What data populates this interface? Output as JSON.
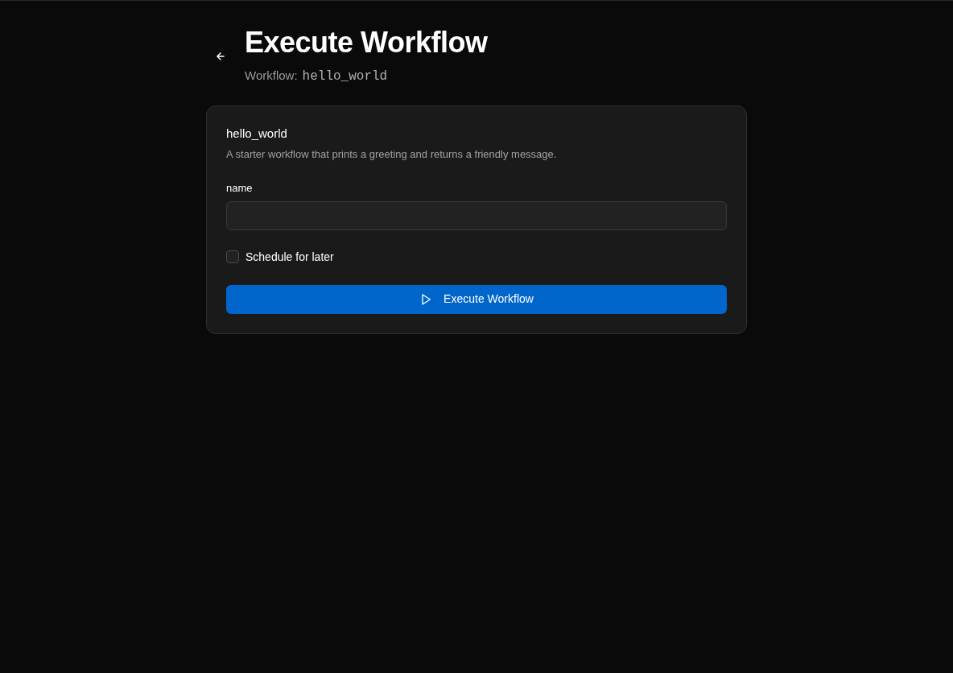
{
  "header": {
    "title": "Execute Workflow",
    "subtitle_label": "Workflow:",
    "workflow_name": "hello_world"
  },
  "card": {
    "title": "hello_world",
    "description": "A starter workflow that prints a greeting and returns a friendly message.",
    "fields": [
      {
        "label": "name"
      }
    ],
    "schedule": {
      "label": "Schedule for later",
      "checked": false
    },
    "submit": {
      "label": "Execute Workflow"
    }
  }
}
